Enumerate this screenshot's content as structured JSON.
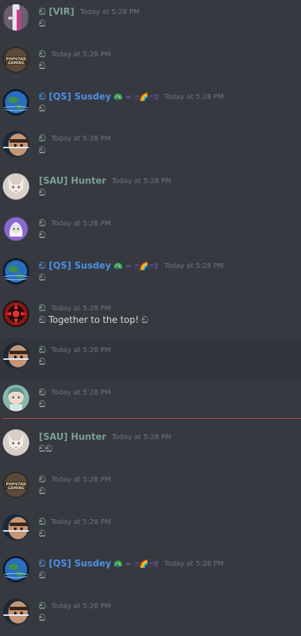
{
  "timestamp_label": "Today at 5:28 PM",
  "colors": {
    "background": "#36393f",
    "hover_row": "#32353b",
    "name_green": "#79a191",
    "name_blue": "#4b8fe6",
    "timestamp": "#72767d",
    "message_text": "#dcddde",
    "new_messages_divider": "#c44a4a"
  },
  "messages": [
    {
      "author": "ඞ [VIR]",
      "author_style": "green",
      "decoration": "",
      "time": "Today at 5:28 PM",
      "text": "ඞ",
      "avatar": "white-pink-glitch-avatar",
      "hover": false
    },
    {
      "author": "ඞ",
      "author_style": "green",
      "decoration": "",
      "time": "Today at 5:28 PM",
      "text": "ඞ",
      "avatar": "popstar-gaming-logo-avatar",
      "hover": false
    },
    {
      "author": "ඞ [QS] Susdey",
      "author_style": "blue",
      "decoration": "🦚 = ෆ🌈ෆ☿",
      "time": "Today at 5:28 PM",
      "text": "ඞ",
      "avatar": "earth-planet-avatar",
      "hover": false
    },
    {
      "author": "ඞ",
      "author_style": "green",
      "decoration": "",
      "time": "Today at 5:28 PM",
      "text": "ඞ",
      "avatar": "face-with-line-avatar",
      "hover": false
    },
    {
      "author": "[SAU] Hunter",
      "author_style": "green",
      "decoration": "",
      "time": "Today at 5:28 PM",
      "text": "ඞ",
      "avatar": "white-fox-avatar",
      "hover": false
    },
    {
      "author": "ඞ",
      "author_style": "green",
      "decoration": "",
      "time": "Today at 5:28 PM",
      "text": "ඞ",
      "avatar": "hooded-ghost-avatar",
      "hover": false
    },
    {
      "author": "ඞ [QS] Susdey",
      "author_style": "blue",
      "decoration": "🦚 = ෆ🌈ෆ☿",
      "time": "Today at 5:28 PM",
      "text": "ඞ",
      "avatar": "earth-planet-avatar",
      "hover": false
    },
    {
      "author": "ඞ",
      "author_style": "green",
      "decoration": "",
      "time": "Today at 5:28 PM",
      "text": "ඞ Together to the top! ඞ",
      "avatar": "red-emblem-avatar",
      "hover": false
    },
    {
      "author": "ඞ",
      "author_style": "green",
      "decoration": "",
      "time": "Today at 5:28 PM",
      "text": "ඞ",
      "avatar": "face-with-line-avatar",
      "hover": true
    },
    {
      "author": "ඞ",
      "author_style": "green",
      "decoration": "",
      "time": "Today at 5:28 PM",
      "text": "ඞ",
      "avatar": "anime-girl-avatar",
      "hover": false
    },
    {
      "author": "[SAU] Hunter",
      "author_style": "green",
      "decoration": "",
      "time": "Today at 5:28 PM",
      "text": "ඞඞ",
      "avatar": "white-fox-avatar",
      "hover": false
    },
    {
      "author": "ඞ",
      "author_style": "green",
      "decoration": "",
      "time": "Today at 5:28 PM",
      "text": "ඞ",
      "avatar": "popstar-gaming-logo-avatar",
      "hover": false
    },
    {
      "author": "ඞ",
      "author_style": "green",
      "decoration": "",
      "time": "Today at 5:28 PM",
      "text": "ඞ",
      "avatar": "face-with-line-avatar",
      "hover": false
    },
    {
      "author": "ඞ [QS] Susdey",
      "author_style": "blue",
      "decoration": "🦚 = ෆ🌈ෆ☿",
      "time": "Today at 5:28 PM",
      "text": "ඞ",
      "avatar": "earth-planet-avatar",
      "hover": false
    },
    {
      "author": "ඞ",
      "author_style": "green",
      "decoration": "",
      "time": "Today at 5:28 PM",
      "text": "ඞ",
      "avatar": "face-with-line-avatar",
      "hover": false
    }
  ],
  "avatar_text": {
    "popstar": "POPSTAR\nGAMING"
  }
}
